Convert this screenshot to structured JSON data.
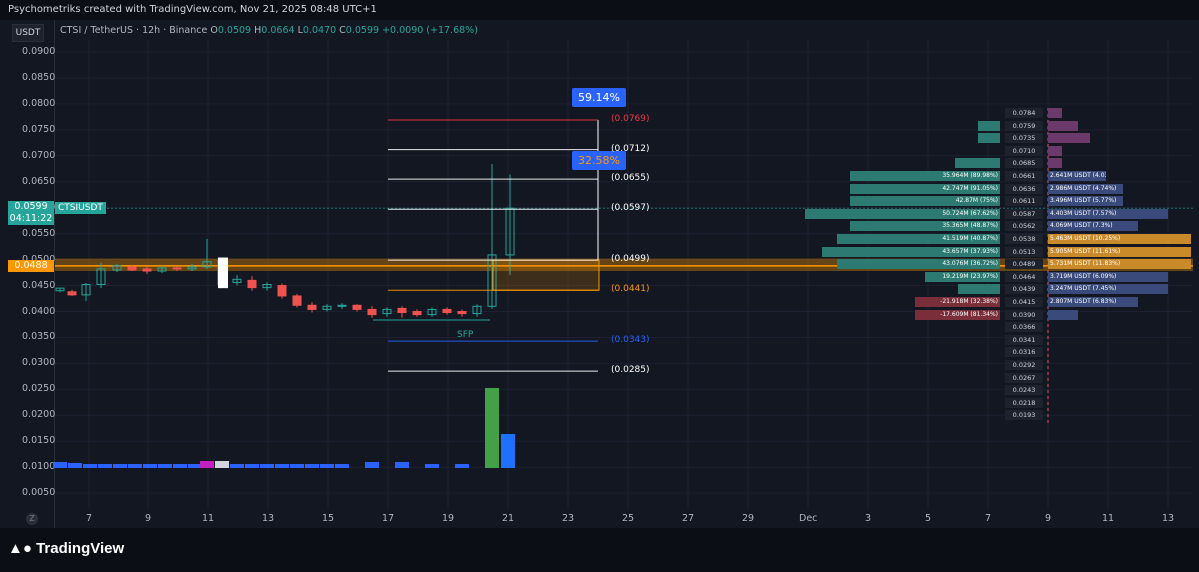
{
  "header": {
    "title": "Psychometriks created with TradingView.com, Nov 21, 2025 08:48 UTC+1"
  },
  "symbol": {
    "quote": "USDT",
    "line": "CTSI / TetherUS · 12h · Binance",
    "o_label": "O",
    "o": "0.0509",
    "h_label": "H",
    "h": "0.0664",
    "l_label": "L",
    "l": "0.0470",
    "c_label": "C",
    "c": "0.0599",
    "change": "+0.0090 (+17.68%)"
  },
  "y_axis": [
    "0.0900",
    "0.0850",
    "0.0800",
    "0.0750",
    "0.0700",
    "0.0650",
    "0.0600",
    "0.0550",
    "0.0500",
    "0.0450",
    "0.0400",
    "0.0350",
    "0.0300",
    "0.0250",
    "0.0200",
    "0.0150",
    "0.0100",
    "0.0050"
  ],
  "price_tags": {
    "last": "0.0599",
    "countdown": "04:11:22",
    "ticker": "CTSIUSDT",
    "line": "0.0488"
  },
  "x_axis": [
    "7",
    "9",
    "11",
    "13",
    "15",
    "17",
    "19",
    "21",
    "23",
    "25",
    "27",
    "29",
    "Dec",
    "3",
    "5",
    "7",
    "9",
    "11",
    "13"
  ],
  "levels": [
    {
      "label": "(0.0769)",
      "color": "#f23645"
    },
    {
      "label": "(0.0712)",
      "color": "#ffffff"
    },
    {
      "label": "(0.0655)",
      "color": "#ffffff"
    },
    {
      "label": "(0.0597)",
      "color": "#ffffff"
    },
    {
      "label": "(0.0499)",
      "color": "#ffffff"
    },
    {
      "label": "(0.0441)",
      "color": "#ff9800"
    },
    {
      "label": "(0.0343)",
      "color": "#2962ff"
    },
    {
      "label": "(0.0285)",
      "color": "#ffffff"
    }
  ],
  "percent_boxes": [
    "59.14%",
    "32.58%"
  ],
  "sfp_label": "SFP",
  "profile": {
    "prices": [
      "0.0784",
      "0.0759",
      "0.0735",
      "0.0710",
      "0.0685",
      "0.0661",
      "0.0636",
      "0.0611",
      "0.0587",
      "0.0562",
      "0.0538",
      "0.0513",
      "0.0489",
      "0.0464",
      "0.0439",
      "0.0415",
      "0.0390",
      "0.0366",
      "0.0341",
      "0.0316",
      "0.0292",
      "0.0267",
      "0.0243",
      "0.0218",
      "0.0193"
    ],
    "left": [
      {
        "t": "",
        "w": 0
      },
      {
        "t": "",
        "w": 22
      },
      {
        "t": "",
        "w": 22
      },
      {
        "t": "",
        "w": 0
      },
      {
        "t": "",
        "w": 45
      },
      {
        "t": "35.964M (89.98%)",
        "w": 150
      },
      {
        "t": "42.747M (91.05%)",
        "w": 150
      },
      {
        "t": "42.87M (75%)",
        "w": 150
      },
      {
        "t": "50.724M (67.62%)",
        "w": 195
      },
      {
        "t": "35.365M (48.87%)",
        "w": 150
      },
      {
        "t": "41.519M (40.87%)",
        "w": 163
      },
      {
        "t": "43.657M (37.93%)",
        "w": 178
      },
      {
        "t": "43.076M (36.72%)",
        "w": 163
      },
      {
        "t": "19.219M (23.97%)",
        "w": 75
      },
      {
        "t": "",
        "w": 42
      },
      {
        "t": "-21.918M (32.38%)",
        "w": 85
      },
      {
        "t": "-17.609M (81.34%)",
        "w": 85
      },
      {
        "t": "",
        "w": 0
      },
      {
        "t": "",
        "w": 0
      },
      {
        "t": "",
        "w": 0
      },
      {
        "t": "",
        "w": 0
      },
      {
        "t": "",
        "w": 0
      },
      {
        "t": "",
        "w": 0
      },
      {
        "t": "",
        "w": 0
      },
      {
        "t": "",
        "w": 0
      }
    ],
    "right": [
      {
        "t": "",
        "w": 14
      },
      {
        "t": "",
        "w": 30
      },
      {
        "t": "",
        "w": 42
      },
      {
        "t": "",
        "w": 14
      },
      {
        "t": "",
        "w": 14
      },
      {
        "t": "2.641M USDT (4.03%)",
        "w": 58
      },
      {
        "t": "2.986M USDT (4.74%)",
        "w": 75
      },
      {
        "t": "3.496M USDT (5.77%)",
        "w": 75
      },
      {
        "t": "4.403M USDT (7.57%)",
        "w": 120
      },
      {
        "t": "4.069M USDT (7.3%)",
        "w": 90
      },
      {
        "t": "5.463M USDT (10.25%)",
        "w": 143
      },
      {
        "t": "5.905M USDT (11.61%)",
        "w": 143
      },
      {
        "t": "5.731M USDT (11.83%)",
        "w": 143
      },
      {
        "t": "3.719M USDT (6.09%)",
        "w": 120
      },
      {
        "t": "3.247M USDT (7.45%)",
        "w": 120
      },
      {
        "t": "2.807M USDT (6.83%)",
        "w": 90
      },
      {
        "t": "",
        "w": 30
      },
      {
        "t": "",
        "w": 0
      },
      {
        "t": "",
        "w": 0
      },
      {
        "t": "",
        "w": 0
      },
      {
        "t": "",
        "w": 0
      },
      {
        "t": "",
        "w": 0
      },
      {
        "t": "",
        "w": 0
      },
      {
        "t": "",
        "w": 0
      },
      {
        "t": "",
        "w": 0
      }
    ]
  },
  "footer": {
    "logo": "TradingView",
    "z": "Z"
  },
  "colors": {
    "bull": "#26a69a",
    "bear": "#ef5350",
    "accent": "#2962ff",
    "orange": "#ff9800",
    "bg": "#131722"
  }
}
